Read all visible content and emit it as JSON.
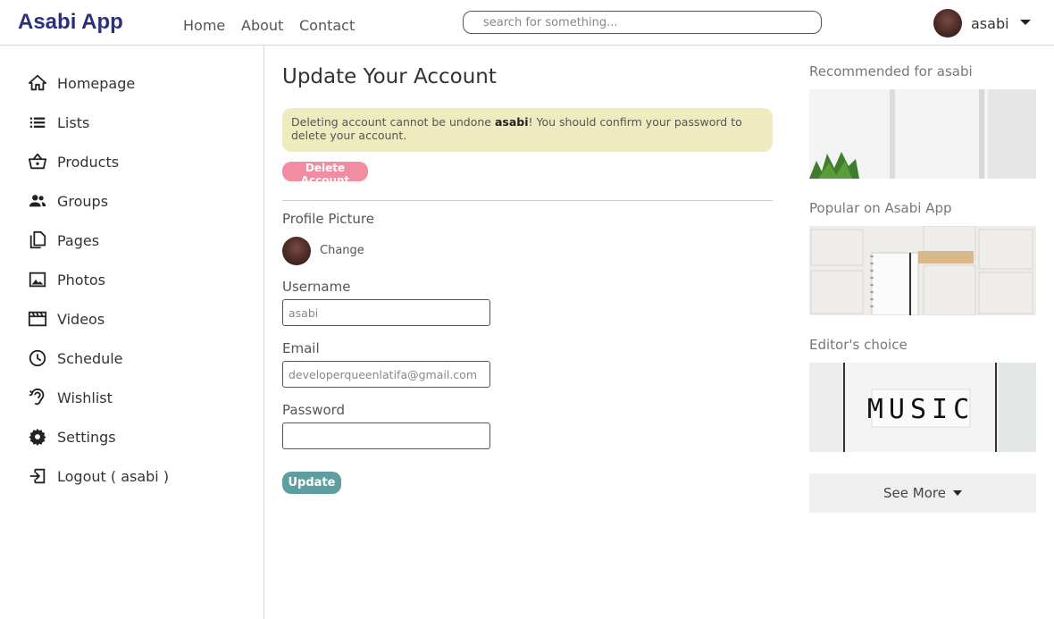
{
  "navbar": {
    "brand": "Asabi App",
    "links": [
      "Home",
      "About",
      "Contact"
    ],
    "search_placeholder": "search for something...",
    "user_name": "asabi"
  },
  "sidebar": {
    "items": [
      {
        "label": "Homepage",
        "icon": "home-icon"
      },
      {
        "label": "Lists",
        "icon": "list-icon"
      },
      {
        "label": "Products",
        "icon": "basket-icon"
      },
      {
        "label": "Groups",
        "icon": "groups-icon"
      },
      {
        "label": "Pages",
        "icon": "pages-icon"
      },
      {
        "label": "Photos",
        "icon": "photo-icon"
      },
      {
        "label": "Videos",
        "icon": "video-icon"
      },
      {
        "label": "Schedule",
        "icon": "clock-icon"
      },
      {
        "label": "Wishlist",
        "icon": "hearing-icon"
      },
      {
        "label": "Settings",
        "icon": "gear-icon"
      },
      {
        "label": "Logout ( asabi )",
        "icon": "logout-icon"
      }
    ]
  },
  "main": {
    "title": "Update Your Account",
    "alert": {
      "prefix": "Deleting account cannot be undone ",
      "user": "asabi",
      "suffix": "! You should confirm your password to delete your account."
    },
    "delete_button": "Delete Account",
    "profile_picture_label": "Profile Picture",
    "change_link": "Change",
    "username_label": "Username",
    "username_value": "asabi",
    "email_label": "Email",
    "email_value": "developerqueenlatifa@gmail.com",
    "password_label": "Password",
    "password_value": "",
    "update_button": "Update"
  },
  "right": {
    "sections": [
      {
        "title": "Recommended for asabi"
      },
      {
        "title": "Popular on Asabi App"
      },
      {
        "title": "Editor's choice",
        "image_text": "MUSIC"
      }
    ],
    "see_more": "See More"
  }
}
